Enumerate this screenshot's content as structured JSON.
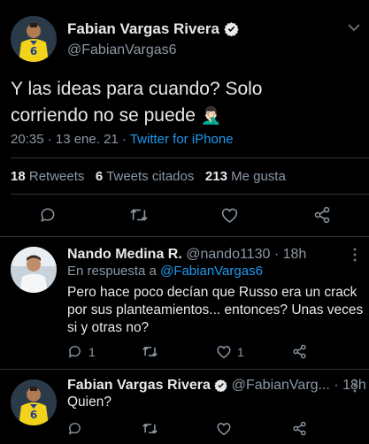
{
  "main_tweet": {
    "author_name": "Fabian Vargas Rivera",
    "handle": "@FabianVargas6",
    "text_line1": "Y las ideas para cuando? Solo",
    "text_line2": "corriendo no se puede",
    "emoji": "🤦🏻‍♂️",
    "time": "20:35 · 13 ene. 21 · ",
    "source": "Twitter for iPhone",
    "retweets_count": "18",
    "retweets_label": "Retweets",
    "quotes_count": "6",
    "quotes_label": "Tweets citados",
    "likes_count": "213",
    "likes_label": "Me gusta"
  },
  "replies": [
    {
      "author_name": "Nando Medina R.",
      "handle": "@nando1130",
      "time": "· 18h",
      "replying_prefix": "En respuesta a ",
      "replying_handle": "@FabianVargas6",
      "text_line1": "Pero hace poco decían que Russo era un crack",
      "text_line2": "por sus planteamientos... entonces? Unas veces",
      "text_line3": "si y otras no?",
      "reply_count": "1",
      "like_count": "1"
    },
    {
      "author_name": "Fabian Vargas Rivera",
      "handle": "@FabianVarg...",
      "time": "· 18h",
      "text": "Quien?"
    }
  ],
  "colors": {
    "background": "#000000",
    "accent": "#1d9bf0",
    "text": "#e7e9ea",
    "muted": "#8b98a5",
    "divider": "#2f3336",
    "jersey_yellow": "#f2d21b",
    "jersey_blue": "#1e3f8f"
  },
  "icons": [
    "verified-badge-icon",
    "chevron-down-icon",
    "reply-icon",
    "retweet-icon",
    "like-icon",
    "share-icon"
  ]
}
